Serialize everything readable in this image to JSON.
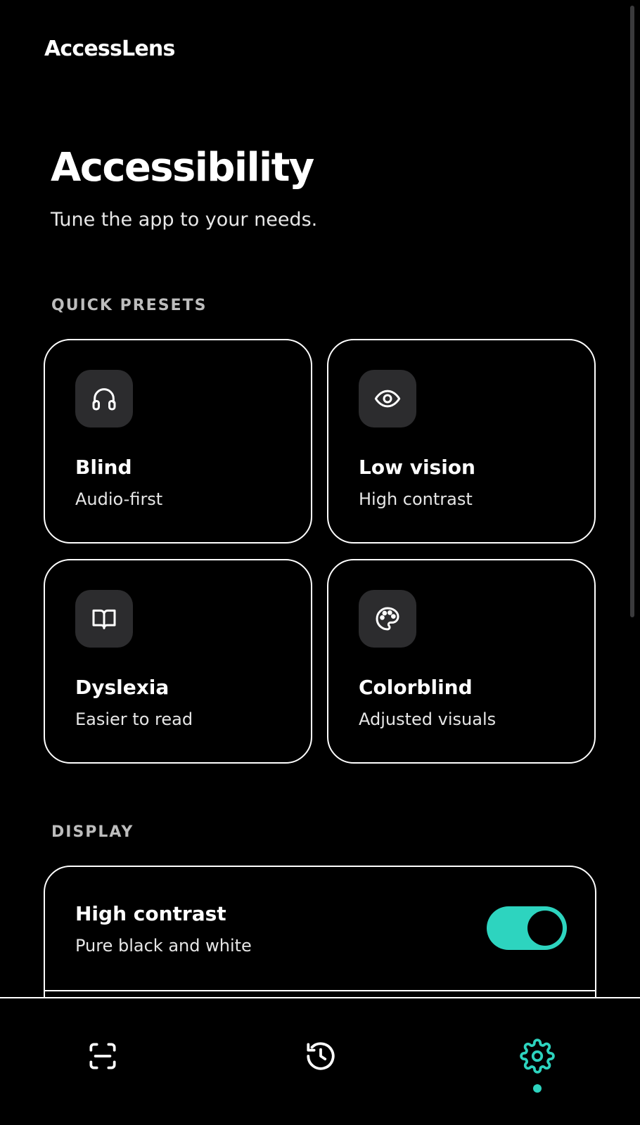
{
  "app": {
    "brand": "AccessLens"
  },
  "header": {
    "title": "Accessibility",
    "subtitle": "Tune the app to your needs."
  },
  "sections": {
    "presets_label": "QUICK PRESETS",
    "display_label": "DISPLAY"
  },
  "presets": [
    {
      "title": "Blind",
      "subtitle": "Audio-first",
      "icon": "headphones-icon"
    },
    {
      "title": "Low vision",
      "subtitle": "High contrast",
      "icon": "eye-icon"
    },
    {
      "title": "Dyslexia",
      "subtitle": "Easier to read",
      "icon": "book-icon"
    },
    {
      "title": "Colorblind",
      "subtitle": "Adjusted visuals",
      "icon": "palette-icon"
    }
  ],
  "display": {
    "settings": [
      {
        "title": "High contrast",
        "subtitle": "Pure black and white",
        "enabled": true
      }
    ]
  },
  "nav": {
    "items": [
      {
        "icon": "scan-icon",
        "active": false
      },
      {
        "icon": "history-icon",
        "active": false
      },
      {
        "icon": "gear-icon",
        "active": true
      }
    ]
  },
  "colors": {
    "accent": "#2dd4bf",
    "background": "#000000",
    "foreground": "#ffffff",
    "icon_tile": "#2c2c2e"
  }
}
